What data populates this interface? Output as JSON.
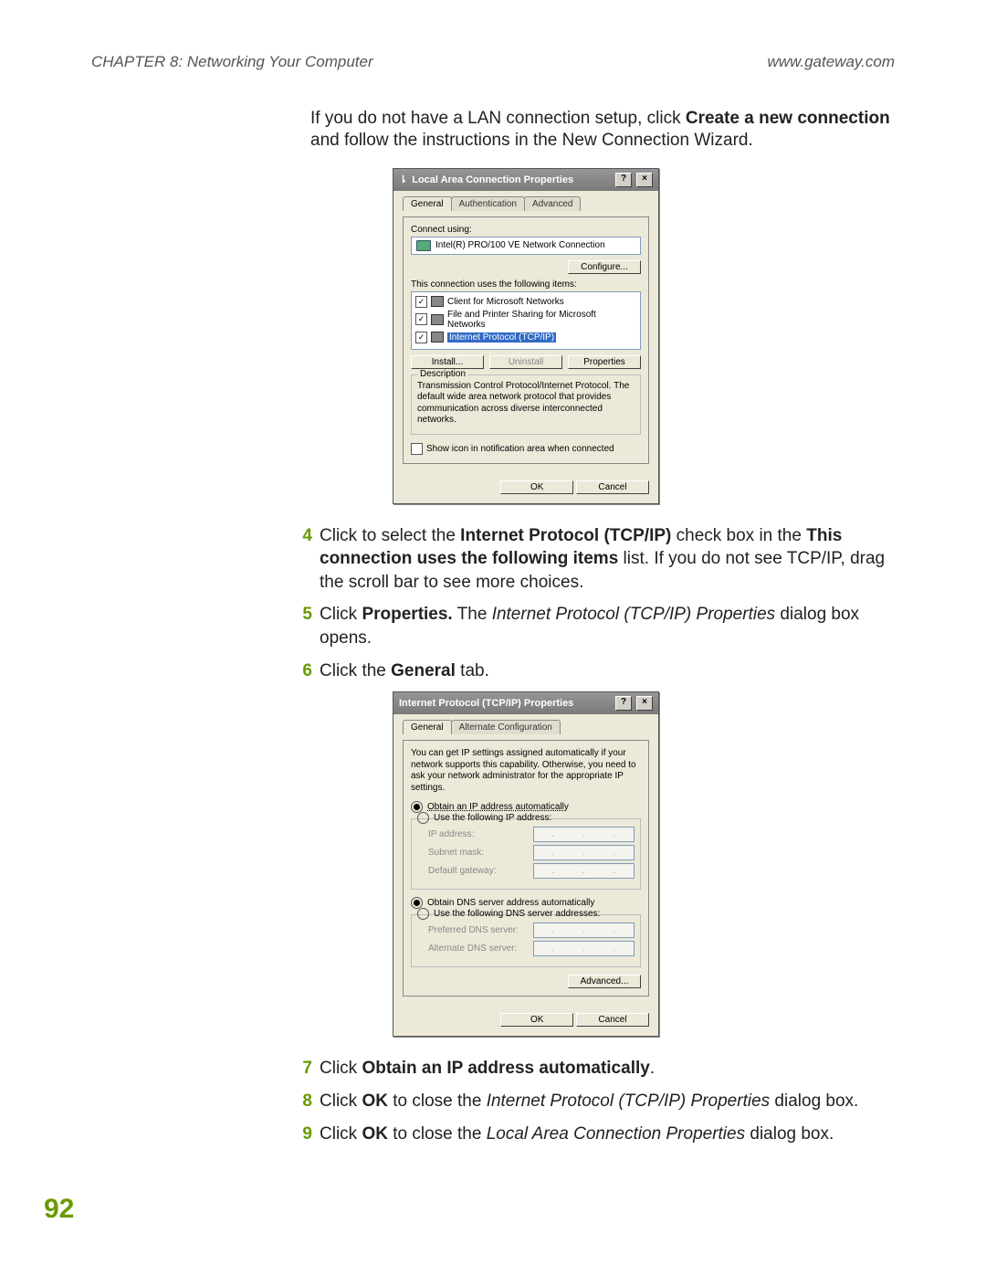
{
  "header": {
    "chapter": "CHAPTER 8: Networking Your Computer",
    "url": "www.gateway.com"
  },
  "intro": {
    "before": "If you do not have a LAN connection setup, click ",
    "bold": "Create a new connection",
    "after": " and follow the instructions in the New Connection Wizard."
  },
  "dialog1": {
    "title": "Local Area Connection Properties",
    "tabs": {
      "general": "General",
      "auth": "Authentication",
      "adv": "Advanced"
    },
    "connect_using_label": "Connect using:",
    "adapter": "Intel(R) PRO/100 VE Network Connection",
    "configure_btn": "Configure...",
    "items_label": "This connection uses the following items:",
    "items": {
      "client": "Client for Microsoft Networks",
      "fps": "File and Printer Sharing for Microsoft Networks",
      "tcpip": "Internet Protocol (TCP/IP)"
    },
    "install_btn": "Install...",
    "uninstall_btn": "Uninstall",
    "properties_btn": "Properties",
    "desc_title": "Description",
    "desc_text": "Transmission Control Protocol/Internet Protocol. The default wide area network protocol that provides communication across diverse interconnected networks.",
    "show_icon": "Show icon in notification area when connected",
    "ok": "OK",
    "cancel": "Cancel"
  },
  "steps_a": {
    "s4": {
      "num": "4",
      "p1": "Click to select the ",
      "b1": "Internet Protocol (TCP/IP)",
      "p2": " check box in the ",
      "b2": "This connection uses the following items",
      "p3": " list. If you do not see TCP/IP, drag the scroll bar to see more choices."
    },
    "s5": {
      "num": "5",
      "p1": "Click ",
      "b1": "Properties.",
      "p2": " The ",
      "i1": "Internet Protocol (TCP/IP) Properties",
      "p3": " dialog box opens."
    },
    "s6": {
      "num": "6",
      "p1": "Click the ",
      "b1": "General",
      "p2": " tab."
    }
  },
  "dialog2": {
    "title": "Internet Protocol (TCP/IP) Properties",
    "tabs": {
      "general": "General",
      "alt": "Alternate Configuration"
    },
    "explain": "You can get IP settings assigned automatically if your network supports this capability. Otherwise, you need to ask your network administrator for the appropriate IP settings.",
    "r_obtain_ip": "Obtain an IP address automatically",
    "r_static_ip": "Use the following IP address:",
    "ip_label": "IP address:",
    "subnet_label": "Subnet mask:",
    "gw_label": "Default gateway:",
    "r_obtain_dns": "Obtain DNS server address automatically",
    "r_static_dns": "Use the following DNS server addresses:",
    "pref_dns": "Preferred DNS server:",
    "alt_dns": "Alternate DNS server:",
    "advanced_btn": "Advanced...",
    "ok": "OK",
    "cancel": "Cancel"
  },
  "steps_b": {
    "s7": {
      "num": "7",
      "p1": "Click ",
      "b1": "Obtain an IP address automatically",
      "p2": "."
    },
    "s8": {
      "num": "8",
      "p1": "Click ",
      "b1": "OK",
      "p2": " to close the ",
      "i1": "Internet Protocol (TCP/IP) Properties",
      "p3": " dialog box."
    },
    "s9": {
      "num": "9",
      "p1": "Click ",
      "b1": "OK",
      "p2": " to close the ",
      "i1": "Local Area Connection Properties",
      "p3": " dialog box."
    }
  },
  "page_number": "92"
}
